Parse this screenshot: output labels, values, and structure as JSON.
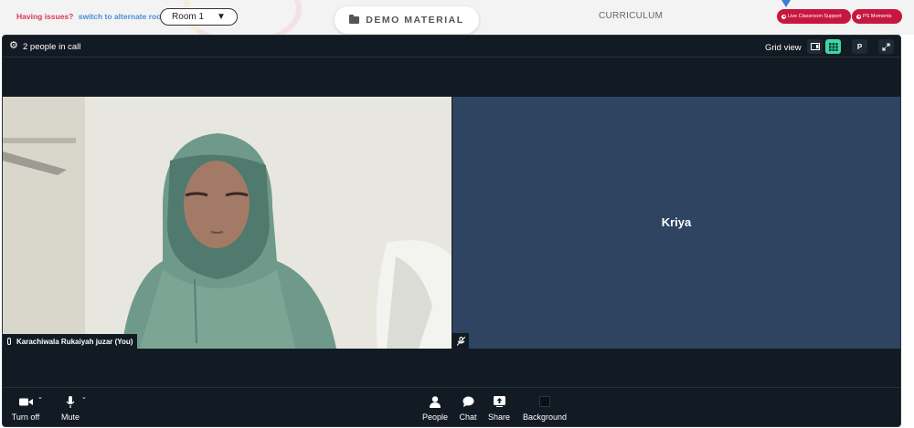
{
  "topbar": {
    "issues_question": "Having issues?",
    "issues_link": "switch to alternate room",
    "room_select": "Room 1",
    "demo_material": "DEMO MATERIAL",
    "curriculum": "CURRICULUM",
    "live_support": "Live Classroom Support",
    "ps_moments": "PS Moments"
  },
  "call": {
    "people_count": "2 people in call",
    "grid_view_label": "Grid view",
    "p_button": "P"
  },
  "participants": [
    {
      "name": "Karachiwala Rukaiyah juzar (You)"
    },
    {
      "name": "Kriya"
    }
  ],
  "controls": {
    "turn_off": "Turn off",
    "mute": "Mute",
    "people": "People",
    "chat": "Chat",
    "share": "Share",
    "background": "Background"
  },
  "colors": {
    "call_bg": "#121b23",
    "remote_tile": "#2e4460",
    "accent_pill": "#c8173f",
    "grid_active": "#3ed6a8"
  }
}
